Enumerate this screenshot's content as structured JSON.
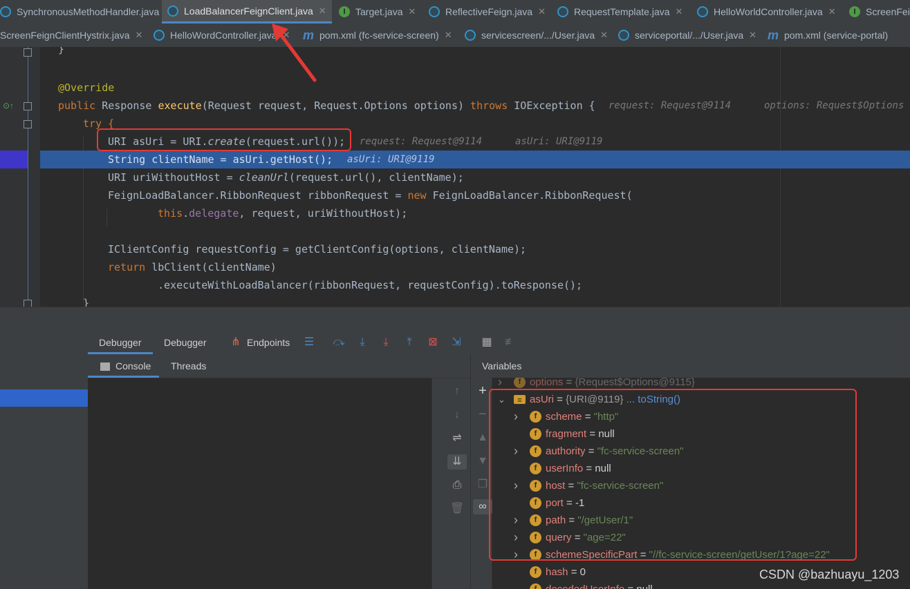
{
  "tabs_row1": [
    {
      "label": "SynchronousMethodHandler.java",
      "icon": "class-icon"
    },
    {
      "label": "LoadBalancerFeignClient.java",
      "icon": "class-icon",
      "active": true
    },
    {
      "label": "Target.java",
      "icon": "interface-icon"
    },
    {
      "label": "ReflectiveFeign.java",
      "icon": "class-icon"
    },
    {
      "label": "RequestTemplate.java",
      "icon": "class-icon"
    },
    {
      "label": "HelloWorldController.java",
      "icon": "class-icon"
    },
    {
      "label": "ScreenFei",
      "icon": "interface-icon"
    }
  ],
  "tabs_row2": [
    {
      "label": "ScreenFeignClientHystrix.java",
      "icon": "none"
    },
    {
      "label": "HelloWordController.java",
      "icon": "class-icon"
    },
    {
      "label": "pom.xml (fc-service-screen)",
      "icon": "maven-icon"
    },
    {
      "label": "servicescreen/.../User.java",
      "icon": "class-icon"
    },
    {
      "label": "serviceportal/.../User.java",
      "icon": "class-icon"
    },
    {
      "label": "pom.xml (service-portal)",
      "icon": "maven-icon"
    }
  ],
  "close_glyph": "✕",
  "code": {
    "l_brace": "}",
    "l_override": "@Override",
    "sig_public": "public ",
    "sig_type": "Response ",
    "sig_fn": "execute",
    "sig_params": "(Request request, Request.Options options) ",
    "sig_throws": "throws ",
    "sig_ex": "IOException {",
    "sig_hint1": "request: Request@9114",
    "sig_hint2": "options: Request$Options",
    "try": "try {",
    "l1_a": "URI asUri = URI.",
    "l1_fn": "create",
    "l1_b": "(request.url());",
    "l1_hint1": "request: Request@9114",
    "l1_hint2": "asUri: URI@9119",
    "l2": "String clientName = asUri.getHost();",
    "l2_hint": "asUri: URI@9119",
    "l3_a": "URI uriWithoutHost = ",
    "l3_fn": "cleanUrl",
    "l3_b": "(request.url(), clientName);",
    "l4_a": "FeignLoadBalancer.RibbonRequest ribbonRequest = ",
    "l4_new": "new ",
    "l4_b": "FeignLoadBalancer.RibbonRequest(",
    "l5_this": "this",
    "l5_dot": ".",
    "l5_fld": "delegate",
    "l5_b": ", request, uriWithoutHost);",
    "l6": "IClientConfig requestConfig = getClientConfig(options, clientName);",
    "l7_ret": "return ",
    "l7_b": "lbClient(clientName)",
    "l8": ".executeWithLoadBalancer(ribbonRequest, requestConfig).toResponse();",
    "l9": "}"
  },
  "debugger": {
    "tabs": [
      "Debugger",
      "Debugger"
    ],
    "endpoints": "Endpoints",
    "subtabs": [
      "Console",
      "Threads"
    ],
    "variables_title": "Variables"
  },
  "variables": [
    {
      "name": "options",
      "value": "{Request$Options@9115}",
      "type": "obj",
      "expand": true,
      "partial": true
    },
    {
      "name": "asUri",
      "value": "{URI@9119}",
      "link": "... toString()",
      "type": "obj",
      "expand": "open",
      "icon": "stack"
    },
    {
      "name": "scheme",
      "value": "\"http\"",
      "type": "str",
      "expand": true
    },
    {
      "name": "fragment",
      "value": "null",
      "type": "num",
      "expand": false
    },
    {
      "name": "authority",
      "value": "\"fc-service-screen\"",
      "type": "str",
      "expand": true
    },
    {
      "name": "userInfo",
      "value": "null",
      "type": "num",
      "expand": false
    },
    {
      "name": "host",
      "value": "\"fc-service-screen\"",
      "type": "str",
      "expand": true
    },
    {
      "name": "port",
      "value": "-1",
      "type": "num",
      "expand": false
    },
    {
      "name": "path",
      "value": "\"/getUser/1\"",
      "type": "str",
      "expand": true
    },
    {
      "name": "query",
      "value": "\"age=22\"",
      "type": "str",
      "expand": true
    },
    {
      "name": "schemeSpecificPart",
      "value": "\"//fc-service-screen/getUser/1?age=22\"",
      "type": "str",
      "expand": true
    },
    {
      "name": "hash",
      "value": "0",
      "type": "num",
      "expand": false
    },
    {
      "name": "decodedUserInfo",
      "value": "null",
      "type": "num",
      "expand": false
    }
  ],
  "watermark": "CSDN @bazhuayu_1203",
  "colors": {
    "highlight": "#e53935",
    "accent": "#4a88c7"
  }
}
